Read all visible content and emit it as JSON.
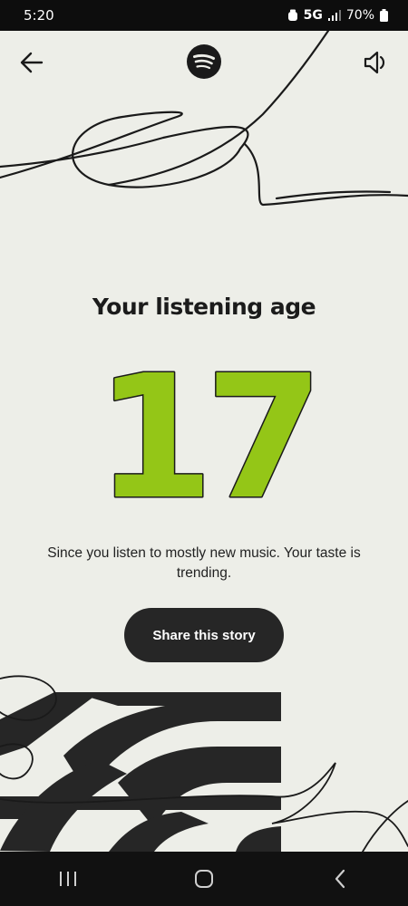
{
  "status_bar": {
    "time": "5:20",
    "network": "5G",
    "battery": "70%"
  },
  "story": {
    "title": "Your listening age",
    "age": "17",
    "caption": "Since you listen to mostly new music. Your taste is trending.",
    "share_label": "Share this story",
    "accent_color": "#94c617",
    "background_color": "#edeee8"
  },
  "icons": {
    "back": "back-arrow-icon",
    "logo": "spotify-logo",
    "sound": "speaker-icon"
  },
  "nav": {
    "recents": "recents-icon",
    "home": "home-icon",
    "back": "back-icon"
  }
}
